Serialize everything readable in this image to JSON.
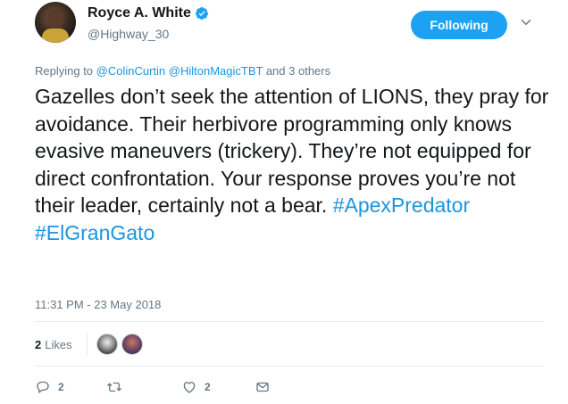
{
  "author": {
    "display_name": "Royce A. White",
    "handle": "@Highway_30",
    "verified": true
  },
  "follow_button_label": "Following",
  "reply_context": {
    "prefix": "Replying to ",
    "mention1": "@ColinCurtin",
    "mention2": "@HiltonMagicTBT",
    "suffix": " and 3 others"
  },
  "tweet": {
    "body": "Gazelles don’t seek the attention of LIONS, they pray for avoidance. Their herbivore programming only knows evasive maneuvers (trickery). They’re not equipped for direct confrontation. Your response proves you’re not their leader, certainly not a bear.",
    "hashtag1": "#ApexPredator",
    "hashtag2": "#ElGranGato",
    "timestamp": "11:31 PM - 23 May 2018"
  },
  "likes": {
    "count": "2",
    "label": "Likes"
  },
  "actions": {
    "reply_count": "2",
    "retweet_count": "",
    "like_count": "2"
  },
  "colors": {
    "accent": "#1da1f2",
    "link": "#1b95e0",
    "muted": "#657786",
    "text": "#14171a"
  },
  "icons": [
    "verified-badge-icon",
    "chevron-down-icon",
    "reply-icon",
    "retweet-icon",
    "heart-icon",
    "message-icon"
  ]
}
